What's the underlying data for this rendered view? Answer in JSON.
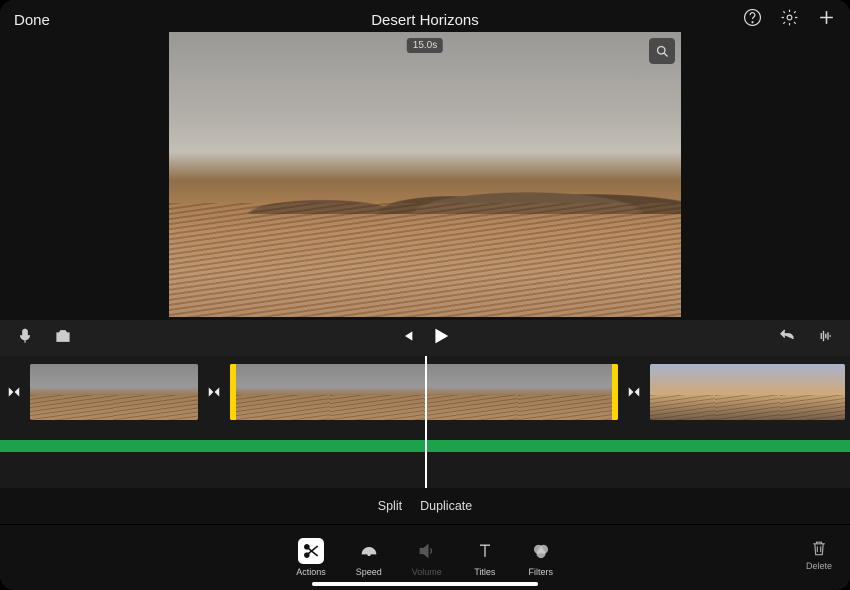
{
  "header": {
    "done": "Done",
    "title": "Desert Horizons"
  },
  "preview": {
    "duration_badge": "15.0s"
  },
  "split_row": {
    "split": "Split",
    "duplicate": "Duplicate"
  },
  "toolbar": {
    "actions": "Actions",
    "speed": "Speed",
    "volume": "Volume",
    "titles": "Titles",
    "filters": "Filters",
    "delete": "Delete"
  }
}
